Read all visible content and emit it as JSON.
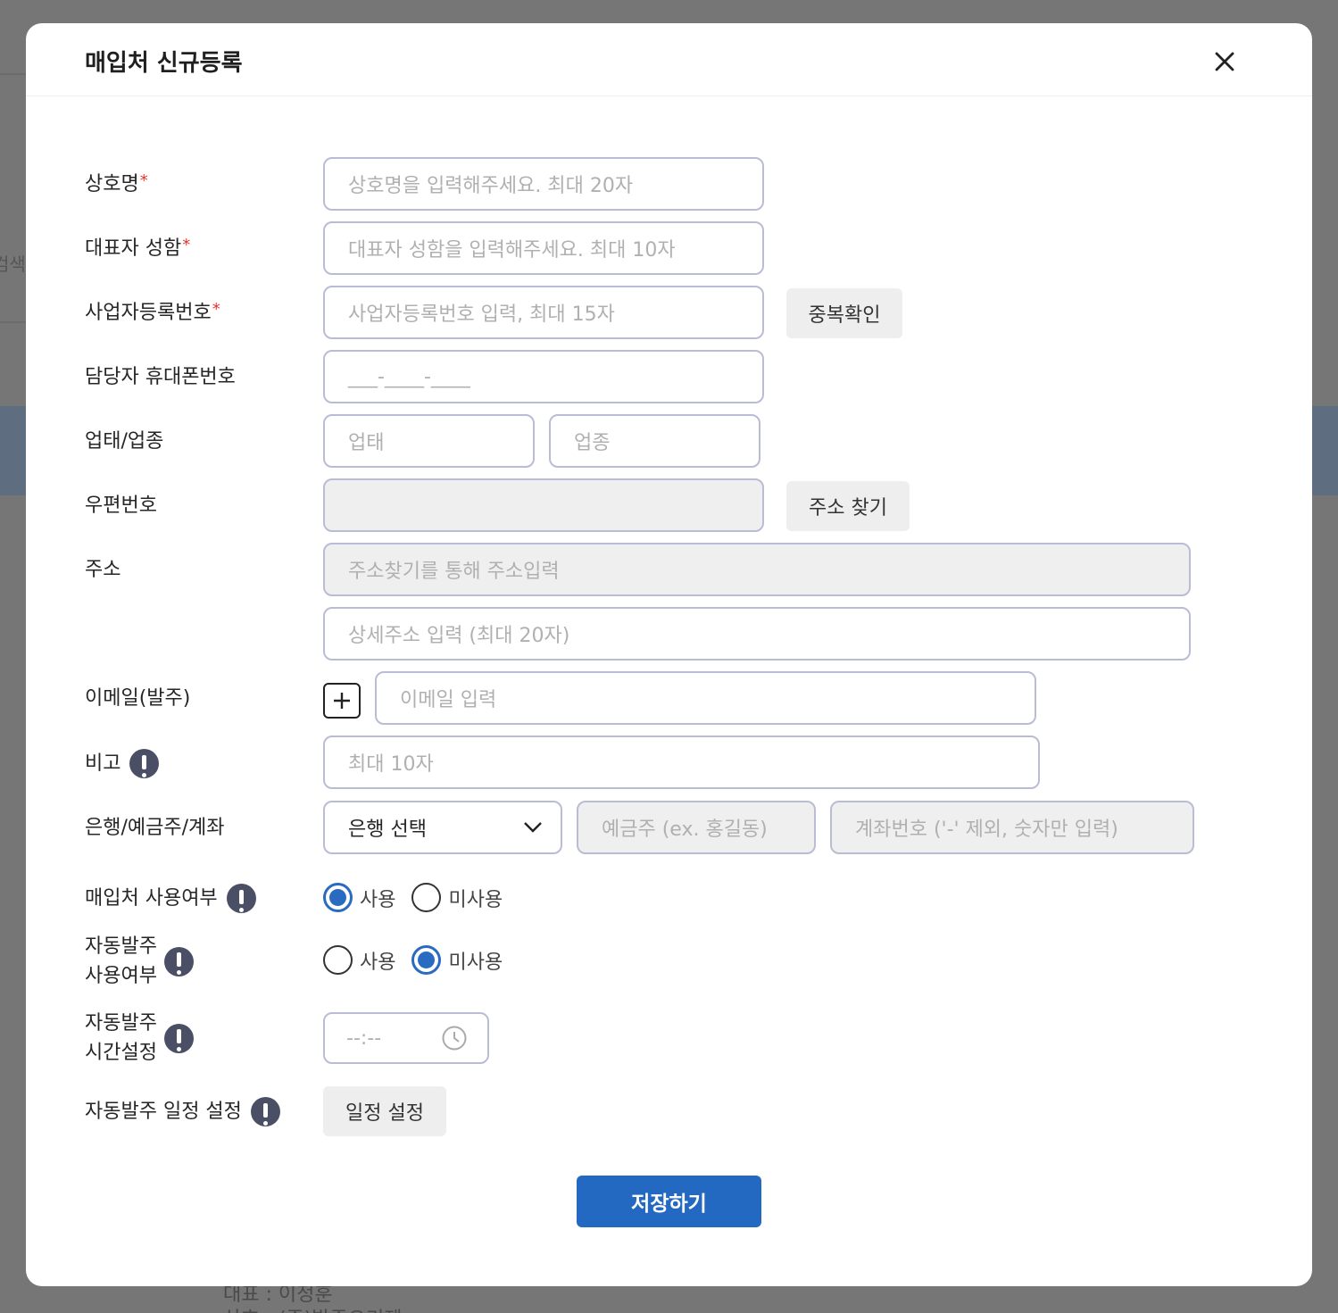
{
  "background": {
    "search_fragment": "검색",
    "bottom_line_1": "대표 : 이정훈",
    "bottom_line_2": "상호 : (주)발주오리젠"
  },
  "modal": {
    "title": "매입처 신규등록",
    "close_icon": "close-icon"
  },
  "form": {
    "business_name": {
      "label": "상호명",
      "required": "*",
      "placeholder": "상호명을 입력해주세요. 최대 20자"
    },
    "ceo_name": {
      "label": "대표자 성함",
      "required": "*",
      "placeholder": "대표자 성함을 입력해주세요. 최대 10자"
    },
    "business_number": {
      "label": "사업자등록번호",
      "required": "*",
      "placeholder": "사업자등록번호 입력, 최대 15자",
      "button": "중복확인"
    },
    "phone": {
      "label": "담당자 휴대폰번호",
      "placeholder": "___-____-____"
    },
    "business_type": {
      "label": "업태/업종",
      "type_placeholder": "업태",
      "item_placeholder": "업종"
    },
    "zipcode": {
      "label": "우편번호",
      "value": "",
      "button": "주소 찾기"
    },
    "address": {
      "label": "주소",
      "placeholder": "주소찾기를 통해 주소입력",
      "detail_placeholder": "상세주소 입력 (최대 20자)"
    },
    "email": {
      "label": "이메일(발주)",
      "placeholder": "이메일 입력",
      "add_icon": "plus-icon"
    },
    "memo": {
      "label": "비고",
      "placeholder": "최대 10자",
      "info_icon": "info-icon"
    },
    "bank": {
      "label": "은행/예금주/계좌",
      "select_value": "은행 선택",
      "holder_placeholder": "예금주 (ex. 홍길동)",
      "account_placeholder": "계좌번호 ('-' 제외, 숫자만 입력)"
    },
    "vendor_use": {
      "label": "매입처 사용여부",
      "options": [
        "사용",
        "미사용"
      ],
      "selected": "사용"
    },
    "auto_order_use": {
      "label_line1": "자동발주",
      "label_line2": "사용여부",
      "options": [
        "사용",
        "미사용"
      ],
      "selected": "미사용"
    },
    "auto_order_time": {
      "label_line1": "자동발주",
      "label_line2": "시간설정",
      "placeholder": "--:--",
      "icon": "clock-icon"
    },
    "auto_order_schedule": {
      "label": "자동발주 일정 설정",
      "button": "일정 설정"
    }
  },
  "actions": {
    "save": "저장하기"
  }
}
